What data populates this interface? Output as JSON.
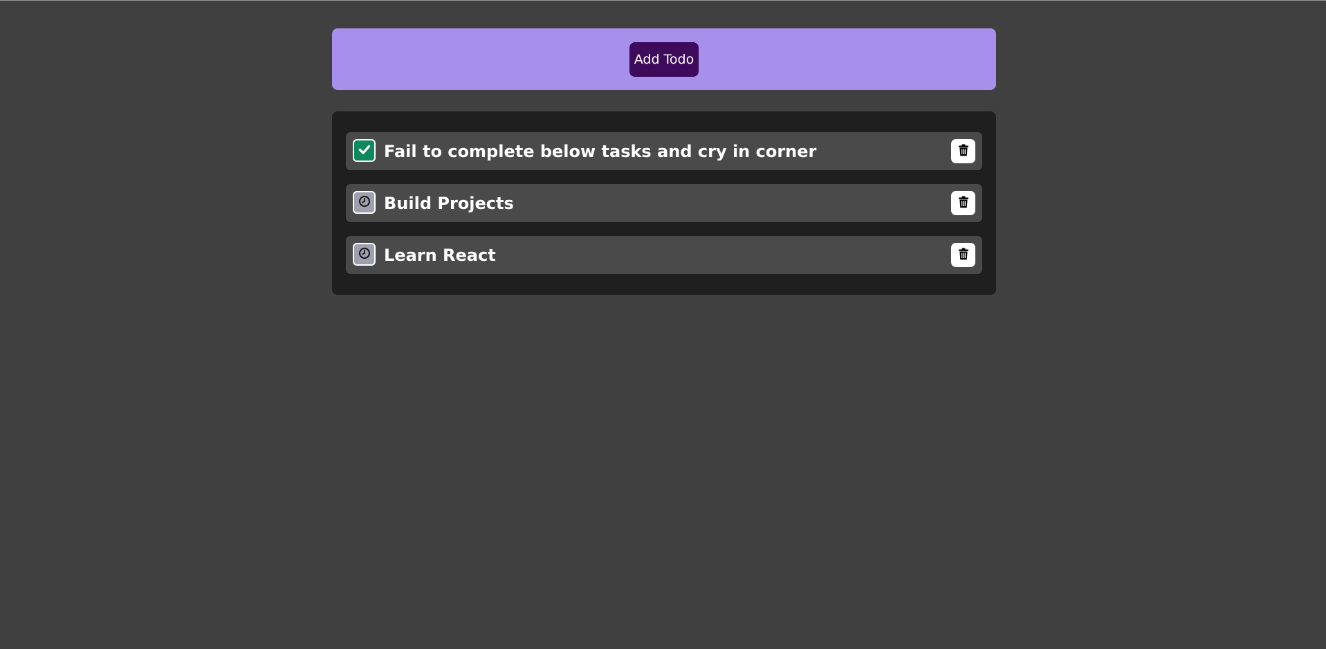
{
  "header": {
    "add_button_label": "Add Todo"
  },
  "todos": [
    {
      "text": "Fail to complete below tasks and cry in corner",
      "status": "done",
      "status_icon": "check-icon"
    },
    {
      "text": "Build Projects",
      "status": "pending",
      "status_icon": "clock-icon"
    },
    {
      "text": "Learn React",
      "status": "pending",
      "status_icon": "clock-icon"
    }
  ],
  "icons": {
    "delete": "trash-icon"
  },
  "colors": {
    "page_background": "#404040",
    "header_background": "#a78fec",
    "add_button_background": "#3d0a5c",
    "list_background": "#1f1f1f",
    "item_background": "#4a4a4a",
    "done_status": "#0c8a5e",
    "pending_status": "#9ea1ad"
  }
}
